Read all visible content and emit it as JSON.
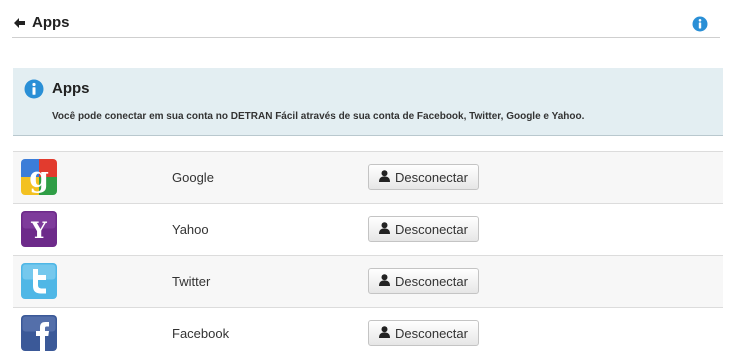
{
  "header": {
    "back_icon": "arrow-left-icon",
    "title": "Apps",
    "info_icon": "info-icon"
  },
  "info_panel": {
    "icon": "info-icon",
    "title": "Apps",
    "text": "Você pode conectar em sua conta no DETRAN Fácil através de sua conta de Facebook, Twitter, Google e Yahoo."
  },
  "apps": [
    {
      "name": "Google",
      "logo": "google-logo-icon",
      "button_label": "Desconectar"
    },
    {
      "name": "Yahoo",
      "logo": "yahoo-logo-icon",
      "button_label": "Desconectar"
    },
    {
      "name": "Twitter",
      "logo": "twitter-logo-icon",
      "button_label": "Desconectar"
    },
    {
      "name": "Facebook",
      "logo": "facebook-logo-icon",
      "button_label": "Desconectar"
    }
  ],
  "colors": {
    "info_blue": "#2a8fd6",
    "panel_bg": "#e3eef2",
    "yahoo_purple": "#6d2a8a",
    "twitter_blue": "#4fb7e6",
    "facebook_blue": "#3b5998"
  }
}
